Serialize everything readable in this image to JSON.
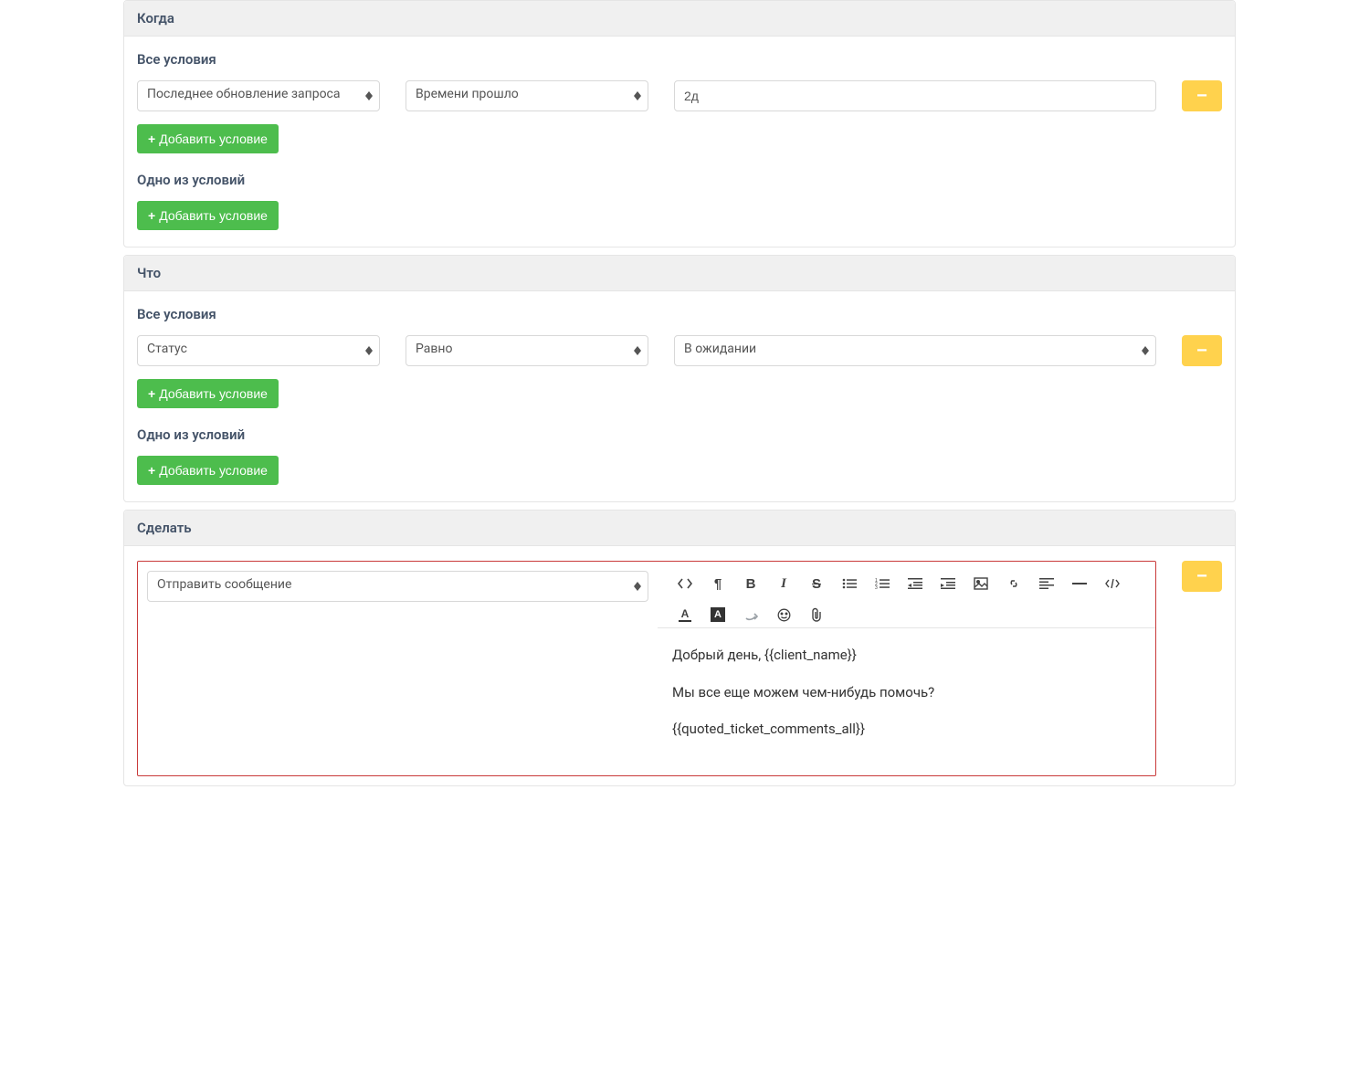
{
  "sections": {
    "when": {
      "title": "Когда",
      "all_conditions_label": "Все условия",
      "one_of_label": "Одно из условий",
      "add_condition_label": "Добавить условие",
      "row": {
        "field": "Последнее обновление запроса",
        "operator": "Времени прошло",
        "value": "2д"
      }
    },
    "what": {
      "title": "Что",
      "all_conditions_label": "Все условия",
      "one_of_label": "Одно из условий",
      "add_condition_label": "Добавить условие",
      "row": {
        "field": "Статус",
        "operator": "Равно",
        "value": "В ожидании"
      }
    },
    "do": {
      "title": "Сделать",
      "action_select": "Отправить сообщение",
      "editor": {
        "line1": "Добрый день, {{client_name}}",
        "line2": "Мы все еще можем чем-нибудь помочь?",
        "line3": "{{quoted_ticket_comments_all}}"
      }
    }
  },
  "icons": {
    "remove": "−"
  }
}
